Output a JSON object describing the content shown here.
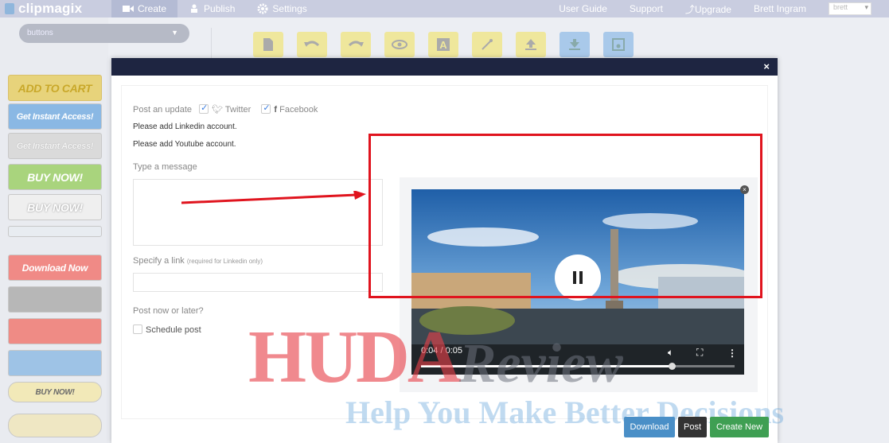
{
  "app": {
    "logo_text": "clipmagix"
  },
  "nav": {
    "items": [
      {
        "label": "Create",
        "icon": "video-camera-icon"
      },
      {
        "label": "Publish",
        "icon": "people-icon"
      },
      {
        "label": "Settings",
        "icon": "gear-icon"
      }
    ],
    "right_links": [
      "User Guide",
      "Support",
      "Upgrade",
      "Brett Ingram"
    ],
    "user_select": "brett"
  },
  "sidebar": {
    "category_select": "buttons",
    "templates": [
      "ADD TO CART",
      "Get Instant Access!",
      "Get Instant Access!",
      "BUY NOW!",
      "BUY NOW!",
      "",
      "Download Now",
      "",
      "",
      "",
      "BUY NOW!",
      ""
    ]
  },
  "toolbar": {
    "buttons": [
      "new-file-icon",
      "undo-icon",
      "redo-icon",
      "preview-eye-icon",
      "text-icon",
      "magic-wand-icon",
      "upload-icon",
      "download-icon",
      "save-icon"
    ]
  },
  "modal": {
    "close": "×",
    "post_update_label": "Post an update",
    "twitter_label": "Twitter",
    "facebook_label": "Facebook",
    "linkedin_note": "Please add Linkedin account.",
    "youtube_note": "Please add Youtube account.",
    "message_label": "Type a message",
    "link_label": "Specify a link",
    "link_hint": "(required for Linkedin only)",
    "post_when_label": "Post now or later?",
    "schedule_label": "Schedule post",
    "video": {
      "time": "0:04 / 0:05",
      "progress_fraction": 0.8
    },
    "buttons": {
      "download": "Download",
      "post": "Post",
      "create_new": "Create New"
    }
  },
  "watermark": {
    "line1": "HUDA",
    "line1b": "Review",
    "line2": "Help You Make Better Decisions"
  },
  "colors": {
    "modal_header": "#1e2541",
    "highlight_box": "#e0141e",
    "download_btn": "#4a8fc7",
    "post_btn": "#333333",
    "create_new_btn": "#3f9f53"
  }
}
